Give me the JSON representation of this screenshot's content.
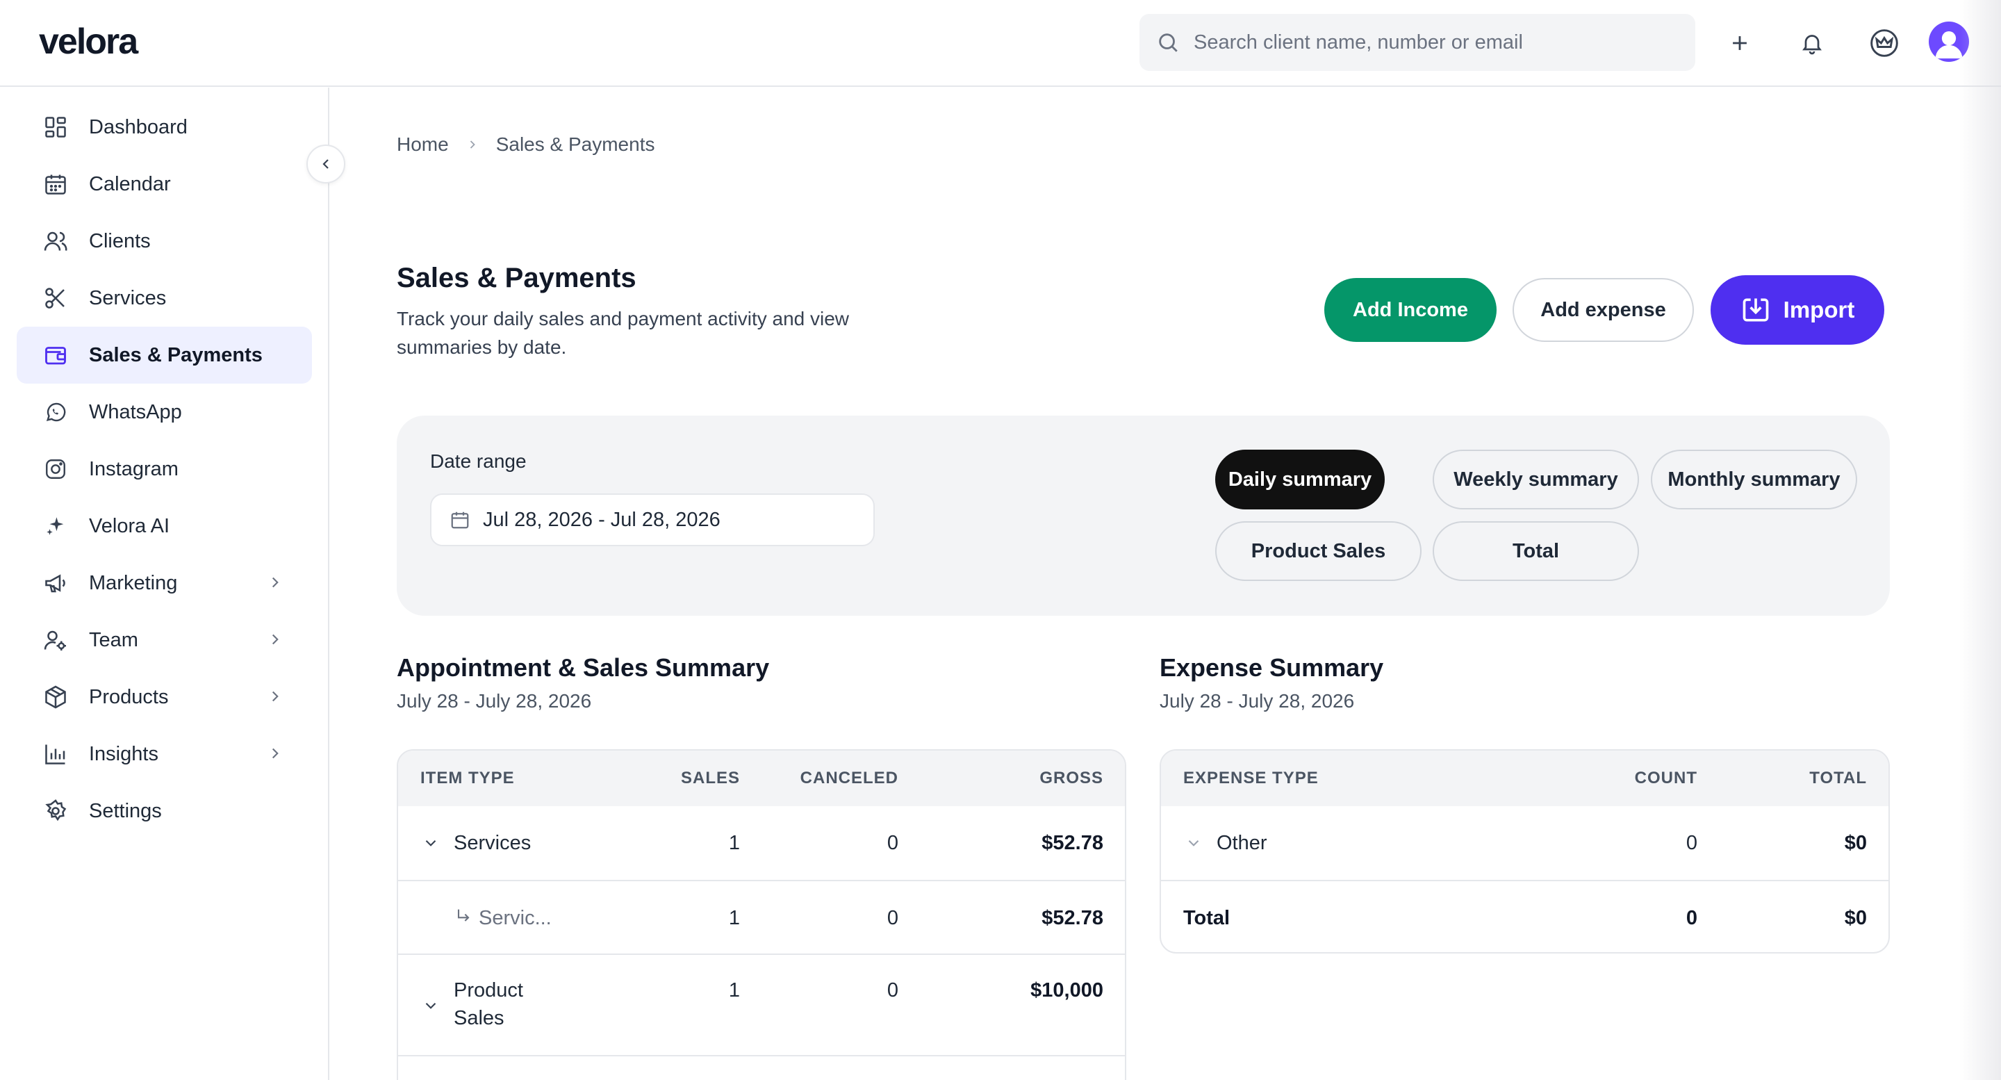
{
  "brand": {
    "logo_text": "velora"
  },
  "search": {
    "placeholder": "Search client name, number or email"
  },
  "topbar_icons": [
    "plus-icon",
    "bell-icon",
    "crown-icon",
    "avatar"
  ],
  "sidebar": {
    "items": [
      {
        "label": "Dashboard",
        "icon": "dashboard-icon"
      },
      {
        "label": "Calendar",
        "icon": "calendar-icon"
      },
      {
        "label": "Clients",
        "icon": "clients-icon"
      },
      {
        "label": "Services",
        "icon": "scissors-icon"
      },
      {
        "label": "Sales & Payments",
        "icon": "wallet-icon",
        "active": true
      },
      {
        "label": "WhatsApp",
        "icon": "whatsapp-icon"
      },
      {
        "label": "Instagram",
        "icon": "instagram-icon"
      },
      {
        "label": "Velora AI",
        "icon": "sparkle-icon"
      },
      {
        "label": "Marketing",
        "icon": "megaphone-icon",
        "expandable": true
      },
      {
        "label": "Team",
        "icon": "team-icon",
        "expandable": true
      },
      {
        "label": "Products",
        "icon": "box-icon",
        "expandable": true
      },
      {
        "label": "Insights",
        "icon": "chart-icon",
        "expandable": true
      },
      {
        "label": "Settings",
        "icon": "gear-icon"
      }
    ]
  },
  "breadcrumb": {
    "home": "Home",
    "current": "Sales & Payments"
  },
  "page": {
    "title": "Sales & Payments",
    "subtitle": "Track your daily sales and payment activity and view summaries by date."
  },
  "actions": {
    "add_income": "Add Income",
    "add_expense": "Add expense",
    "import": "Import"
  },
  "filters": {
    "date_range_label": "Date range",
    "date_range_value": "Jul 28, 2026 - Jul 28, 2026",
    "tabs": [
      "Daily summary",
      "Weekly summary",
      "Monthly summary",
      "Product Sales",
      "Total"
    ],
    "active_tab": "Daily summary"
  },
  "sales_summary": {
    "title": "Appointment & Sales Summary",
    "period": "July 28 - July 28, 2026",
    "columns": [
      "ITEM TYPE",
      "SALES",
      "CANCELED",
      "GROSS"
    ],
    "rows": [
      {
        "type": "Services",
        "sales": "1",
        "canceled": "0",
        "gross": "$52.78"
      },
      {
        "type": "Servic...",
        "sales": "1",
        "canceled": "0",
        "gross": "$52.78"
      },
      {
        "type_line1": "Product",
        "type_line2": "Sales",
        "sales": "1",
        "canceled": "0",
        "gross": "$10,000"
      }
    ]
  },
  "expense_summary": {
    "title": "Expense Summary",
    "period": "July 28 - July 28, 2026",
    "columns": [
      "EXPENSE TYPE",
      "COUNT",
      "TOTAL"
    ],
    "rows": [
      {
        "type": "Other",
        "count": "0",
        "total": "$0"
      },
      {
        "type": "Total",
        "count": "0",
        "total": "$0"
      }
    ]
  },
  "colors": {
    "accent": "#4f2ff0",
    "income": "#059669",
    "active_nav_bg": "#eef0ff",
    "active_pill": "#111111"
  }
}
